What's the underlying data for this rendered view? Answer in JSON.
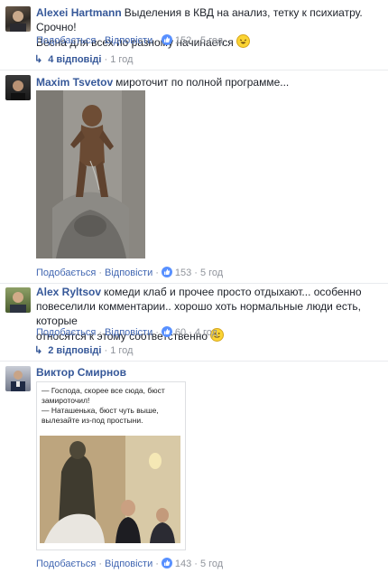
{
  "comments": [
    {
      "author": "Alexei Hartmann",
      "text_line1": "Выделения в КВД на анализ, тетку к психиатру. Срочно!",
      "text_line2": "Весна для всех по разному начинается",
      "like_label": "Подобається",
      "reply_label": "Відповісти",
      "likes": "152",
      "time": "5 год",
      "replies_count": "4 відповіді",
      "replies_time": "1 год"
    },
    {
      "author": "Maxim Tsvetov",
      "text_line1": "мироточит по полной программе...",
      "like_label": "Подобається",
      "reply_label": "Відповісти",
      "likes": "153",
      "time": "5 год"
    },
    {
      "author": "Alex Ryltsov",
      "text_line1": "комеди клаб и прочее просто отдыхают... особенно",
      "text_line2": "повеселили комментарии.. хорошо хоть нормальные люди есть, которые",
      "text_line3": "относятся к этому соответственно",
      "like_label": "Подобається",
      "reply_label": "Відповісти",
      "likes": "60",
      "time": "4 год",
      "replies_count": "2 відповіді",
      "replies_time": "1 год"
    },
    {
      "author": "Виктор Смирнов",
      "meme_line1": "— Господа, скорее все сюда, бюст",
      "meme_line2": "замироточил!",
      "meme_line3": "— Наташенька, бюст чуть выше,",
      "meme_line4": "вылезайте из-под простыни.",
      "like_label": "Подобається",
      "reply_label": "Відповісти",
      "likes": "143",
      "time": "5 год"
    }
  ],
  "colors": {
    "link": "#365899",
    "action": "#4267b2",
    "meta": "#90949c",
    "like_badge": "#5890ff"
  },
  "icons": [
    "avatar",
    "like-icon",
    "reply-arrow-icon",
    "laughing-emoji-icon",
    "smiley-emoji-icon"
  ]
}
